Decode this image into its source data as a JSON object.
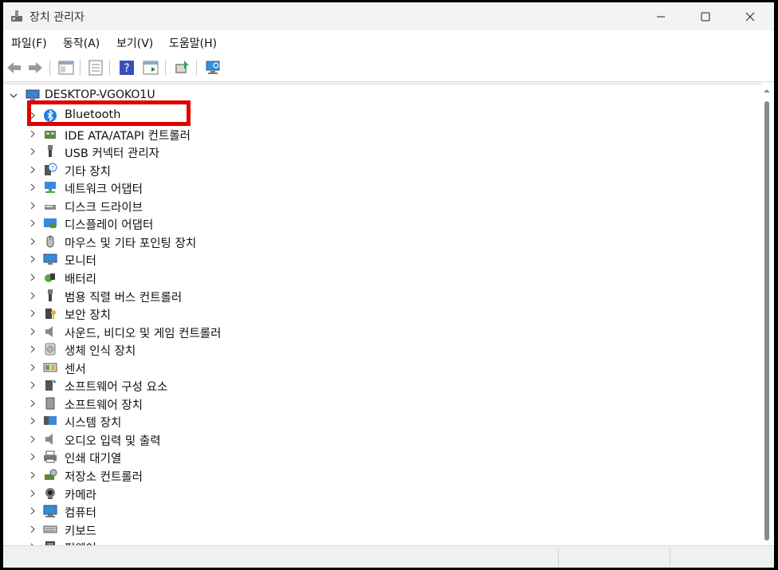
{
  "window": {
    "title": "장치 관리자"
  },
  "menu": [
    {
      "label": "파일(F)"
    },
    {
      "label": "동작(A)"
    },
    {
      "label": "보기(V)"
    },
    {
      "label": "도움말(H)"
    }
  ],
  "tree": {
    "root_label": "DESKTOP-VGOKO1U",
    "categories": [
      {
        "label": "Bluetooth",
        "icon": "bluetooth-icon"
      },
      {
        "label": "IDE ATA/ATAPI 컨트롤러",
        "icon": "ide-controller-icon"
      },
      {
        "label": "USB 커넥터 관리자",
        "icon": "usb-connector-icon"
      },
      {
        "label": "기타 장치",
        "icon": "unknown-device-icon"
      },
      {
        "label": "네트워크 어댑터",
        "icon": "network-adapter-icon"
      },
      {
        "label": "디스크 드라이브",
        "icon": "disk-drive-icon"
      },
      {
        "label": "디스플레이 어댑터",
        "icon": "display-adapter-icon"
      },
      {
        "label": "마우스 및 기타 포인팅 장치",
        "icon": "mouse-icon"
      },
      {
        "label": "모니터",
        "icon": "monitor-icon"
      },
      {
        "label": "배터리",
        "icon": "battery-icon"
      },
      {
        "label": "범용 직렬 버스 컨트롤러",
        "icon": "usb-controller-icon"
      },
      {
        "label": "보안 장치",
        "icon": "security-device-icon"
      },
      {
        "label": "사운드, 비디오 및 게임 컨트롤러",
        "icon": "speaker-icon"
      },
      {
        "label": "생체 인식 장치",
        "icon": "fingerprint-icon"
      },
      {
        "label": "센서",
        "icon": "sensor-icon"
      },
      {
        "label": "소프트웨어 구성 요소",
        "icon": "software-component-icon"
      },
      {
        "label": "소프트웨어 장치",
        "icon": "software-device-icon"
      },
      {
        "label": "시스템 장치",
        "icon": "system-device-icon"
      },
      {
        "label": "오디오 입력 및 출력",
        "icon": "audio-io-icon"
      },
      {
        "label": "인쇄 대기열",
        "icon": "printer-icon"
      },
      {
        "label": "저장소 컨트롤러",
        "icon": "storage-controller-icon"
      },
      {
        "label": "카메라",
        "icon": "camera-icon"
      },
      {
        "label": "컴퓨터",
        "icon": "computer-icon"
      },
      {
        "label": "키보드",
        "icon": "keyboard-icon"
      },
      {
        "label": "펌웨어",
        "icon": "firmware-icon"
      }
    ]
  },
  "colors": {
    "highlight": "#e00000",
    "bluetooth": "#1a7fe8"
  }
}
